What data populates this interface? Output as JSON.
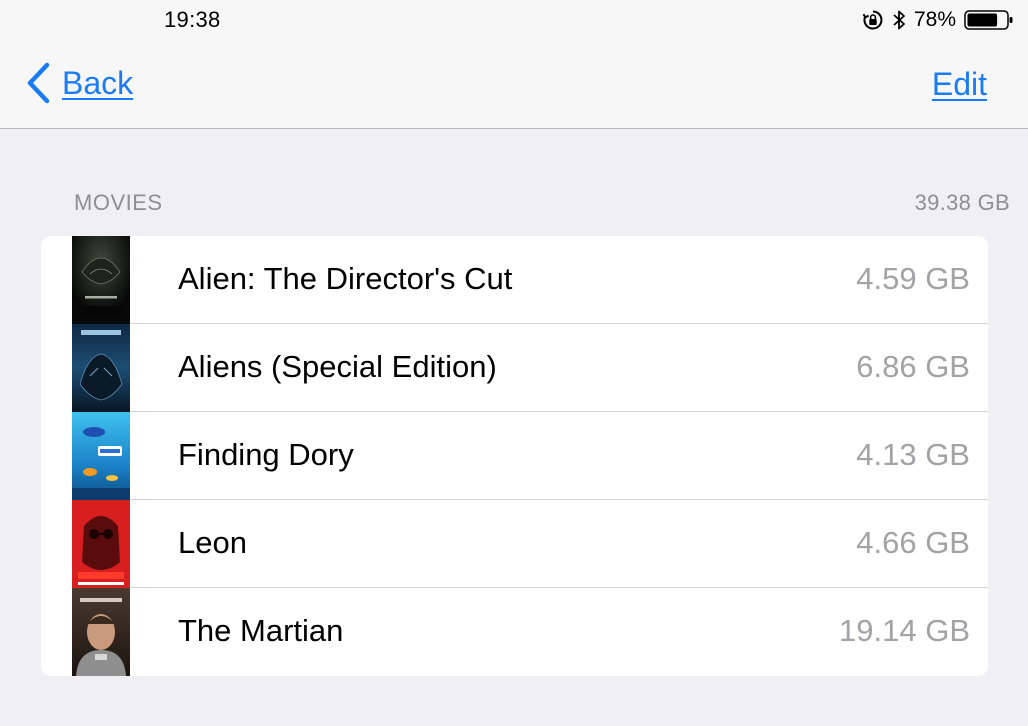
{
  "status_bar": {
    "time": "19:38",
    "battery_percent": "78%",
    "battery_level": 0.78,
    "icons": [
      "rotation-lock-icon",
      "bluetooth-icon",
      "battery-icon"
    ]
  },
  "nav": {
    "back_label": "Back",
    "edit_label": "Edit",
    "accent_color": "#1a7cf5"
  },
  "section": {
    "header": "MOVIES",
    "total": "39.38 GB"
  },
  "movies": [
    {
      "title": "Alien: The Director's Cut",
      "size": "4.59 GB",
      "poster_icon": "alien-poster-icon"
    },
    {
      "title": "Aliens (Special Edition)",
      "size": "6.86 GB",
      "poster_icon": "aliens-poster-icon"
    },
    {
      "title": "Finding Dory",
      "size": "4.13 GB",
      "poster_icon": "finding-dory-poster-icon"
    },
    {
      "title": "Leon",
      "size": "4.66 GB",
      "poster_icon": "leon-poster-icon"
    },
    {
      "title": "The Martian",
      "size": "19.14 GB",
      "poster_icon": "the-martian-poster-icon"
    }
  ]
}
